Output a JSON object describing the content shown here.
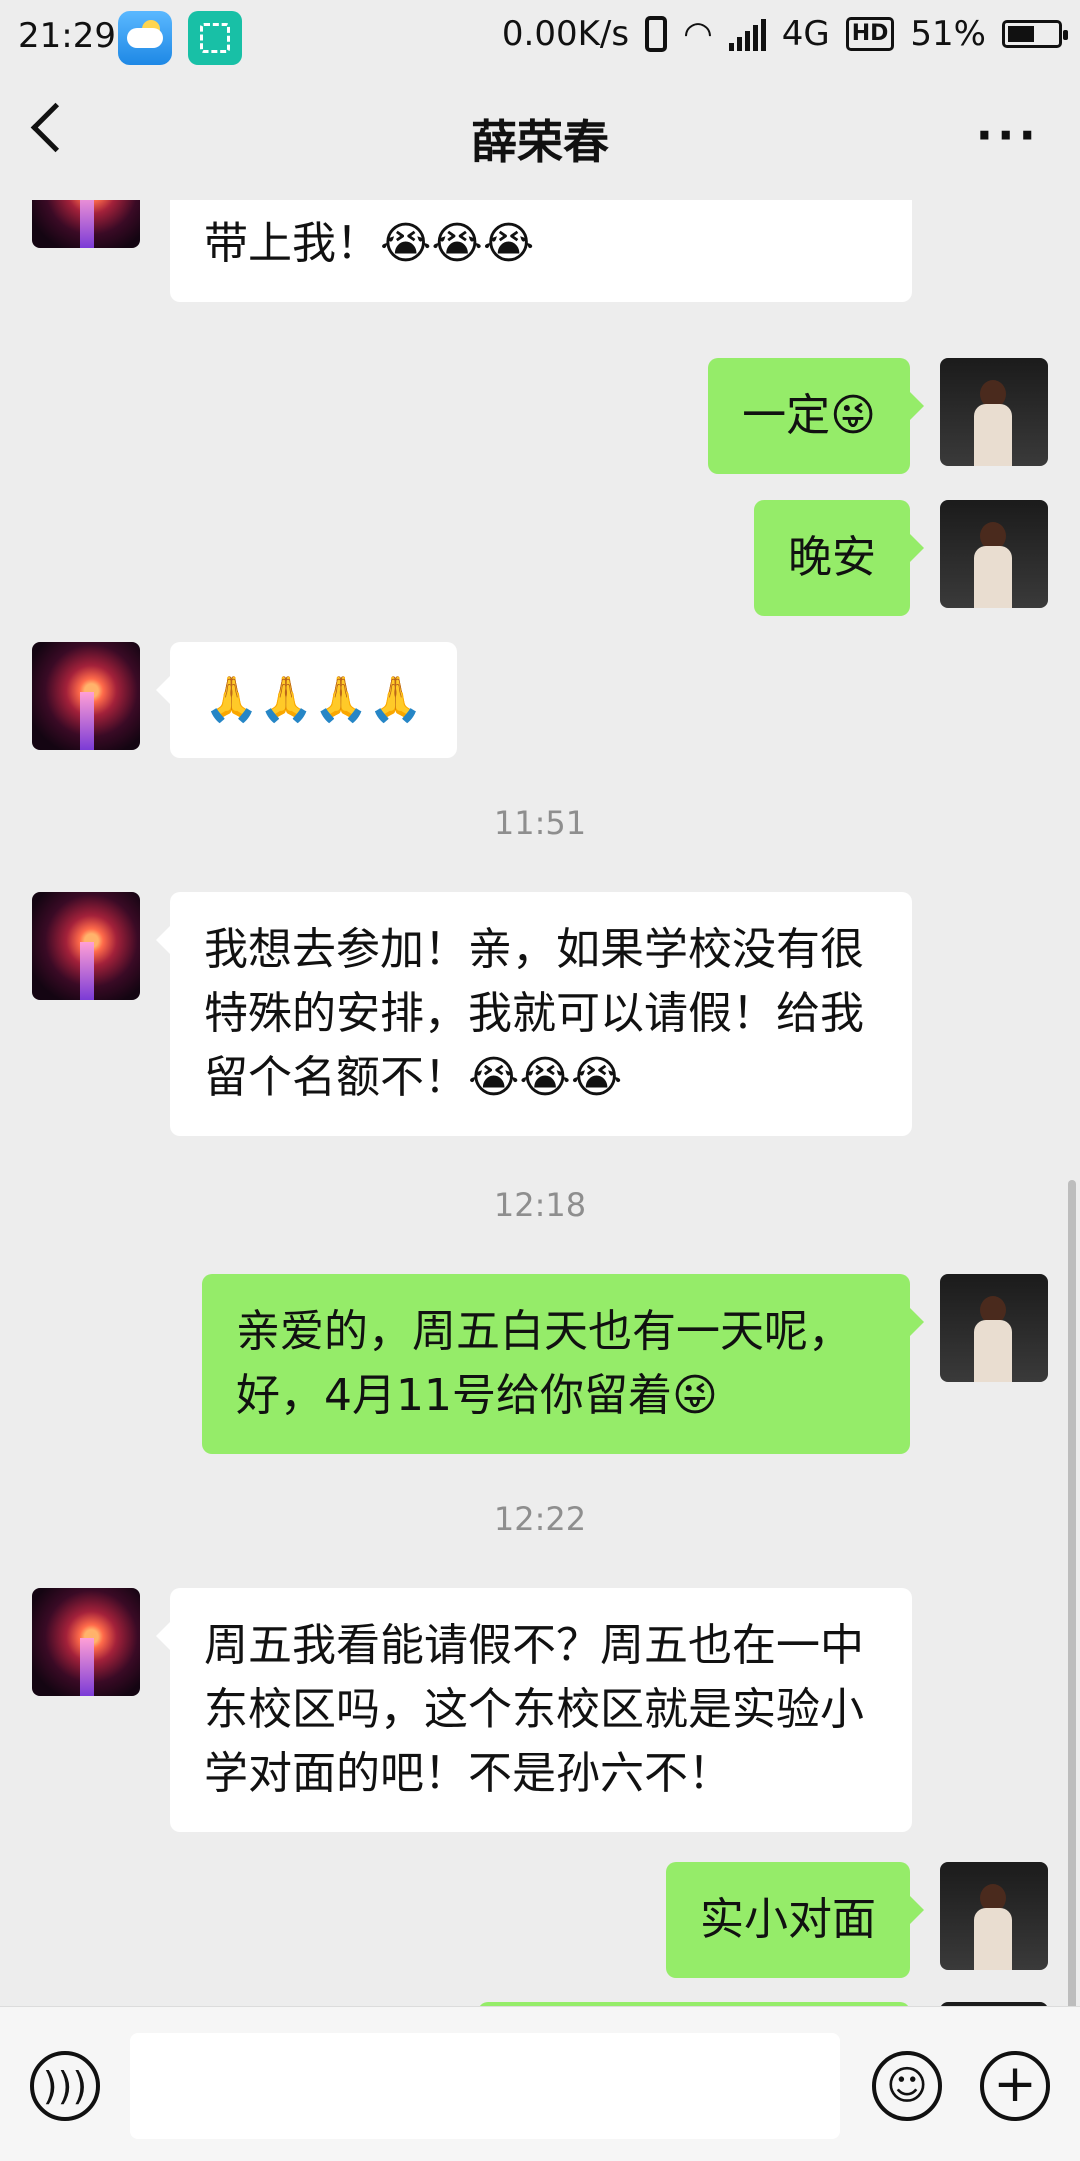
{
  "status_bar": {
    "time": "21:29",
    "net_speed": "0.00K/s",
    "network": "4G",
    "hd": "HD",
    "battery": "51%"
  },
  "header": {
    "title": "薛荣春",
    "more": "···"
  },
  "chat": {
    "messages": [
      {
        "side": "left",
        "text": "佩服您的学习力！有好的学习机会带上我！😭😭😭"
      },
      {
        "side": "right",
        "text": "一定😜"
      },
      {
        "side": "right",
        "text": "晚安"
      },
      {
        "side": "left",
        "text": "🙏🙏🙏🙏"
      },
      {
        "time": "11:51"
      },
      {
        "side": "left",
        "text": "我想去参加！亲，如果学校没有很特殊的安排，我就可以请假！给我留个名额不！😭😭😭"
      },
      {
        "time": "12:18"
      },
      {
        "side": "right",
        "text": "亲爱的，周五白天也有一天呢，好，4月11号给你留着😜"
      },
      {
        "time": "12:22"
      },
      {
        "side": "left",
        "text": "周五我看能请假不？周五也在一中东校区吗，这个东校区就是实验小学对面的吧！不是孙六不！"
      },
      {
        "side": "right",
        "text": "实小对面"
      }
    ]
  },
  "input_bar": {
    "voice_icon": "voice-icon",
    "emoji_icon": "emoji-icon",
    "plus_icon": "plus-icon"
  }
}
